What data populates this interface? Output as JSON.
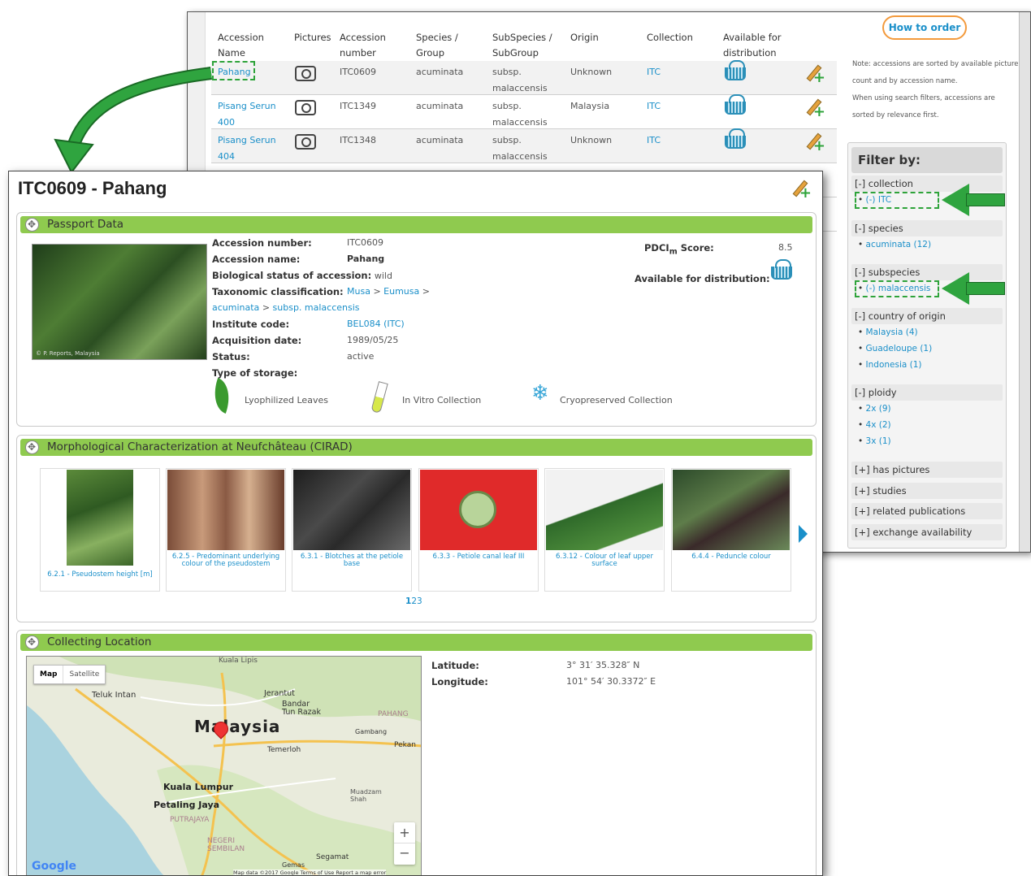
{
  "list": {
    "headers": {
      "name": "Accession\nName",
      "pictures": "Pictures",
      "number": "Accession\nnumber",
      "species": "Species /\nGroup",
      "subspecies": "SubSpecies /\nSubGroup",
      "origin": "Origin",
      "collection": "Collection",
      "available": "Available for\ndistribution"
    },
    "rows": [
      {
        "name": "Pahang",
        "number": "ITC0609",
        "species": "acuminata",
        "subspecies": "subsp.\nmalaccensis",
        "origin": "Unknown",
        "collection": "ITC"
      },
      {
        "name": "Pisang Serun\n400",
        "number": "ITC1349",
        "species": "acuminata",
        "subspecies": "subsp.\nmalaccensis",
        "origin": "Malaysia",
        "collection": "ITC"
      },
      {
        "name": "Pisang Serun\n404",
        "number": "ITC1348",
        "species": "acuminata",
        "subspecies": "subsp.\nmalaccensis",
        "origin": "Unknown",
        "collection": "ITC"
      }
    ],
    "how_to_order": "How to order",
    "note1": "Note: accessions are sorted by available picture count and by accession name.",
    "note2": "When using search filters, accessions are sorted by relevance first."
  },
  "filter": {
    "title": "Filter by:",
    "collection": {
      "head": "[-] collection",
      "items": [
        "(-) ITC"
      ]
    },
    "species": {
      "head": "[-] species",
      "items": [
        "acuminata (12)"
      ]
    },
    "subspecies": {
      "head": "[-] subspecies",
      "items": [
        "(-) malaccensis"
      ]
    },
    "country": {
      "head": "[-] country of origin",
      "items": [
        "Malaysia (4)",
        "Guadeloupe (1)",
        "Indonesia (1)"
      ]
    },
    "ploidy": {
      "head": "[-] ploidy",
      "items": [
        "2x (9)",
        "4x (2)",
        "3x (1)"
      ]
    },
    "collapsed": [
      "[+] has pictures",
      "[+] studies",
      "[+] related publications",
      "[+] exchange availability"
    ]
  },
  "detail": {
    "title": "ITC0609 - Pahang",
    "passport": {
      "head": "Passport Data",
      "photo_credit": "© P. Reports, Malaysia",
      "accession_number_label": "Accession number:",
      "accession_number": "ITC0609",
      "accession_name_label": "Accession name:",
      "accession_name": "Pahang",
      "bio_status_label": "Biological status of accession:",
      "bio_status": "wild",
      "taxonomic_label": "Taxonomic classification:",
      "taxonomy_musa": "Musa",
      "taxonomy_sep1": ">",
      "taxonomy_eumusa": "Eumusa",
      "taxonomy_sep2": ">",
      "taxonomy_acuminata": "acuminata",
      "taxonomy_sep3": ">",
      "taxonomy_subsp": "subsp. malaccensis",
      "institute_label": "Institute code:",
      "institute": "BEL084 (ITC)",
      "acquisition_label": "Acquisition date:",
      "acquisition": "1989/05/25",
      "status_label": "Status:",
      "status": "active",
      "storage_label": "Type of storage:",
      "storage": [
        "Lyophilized Leaves",
        "In Vitro Collection",
        "Cryopreserved Collection"
      ],
      "pdci_label_pre": "PDCI",
      "pdci_label_sub": "m",
      "pdci_label_post": " Score:",
      "pdci": "8.5",
      "available_label": "Available for distribution:"
    },
    "morph": {
      "head": "Morphological Characterization at Neufchâteau (CIRAD)",
      "items": [
        "6.2.1 - Pseudostem height [m]",
        "6.2.5 - Predominant underlying colour of the pseudostem",
        "6.3.1 - Blotches at the petiole base",
        "6.3.3 - Petiole canal leaf III",
        "6.3.12 - Colour of leaf upper surface",
        "6.4.4 - Peduncle colour"
      ],
      "pages": [
        "1",
        "2",
        "3"
      ]
    },
    "location": {
      "head": "Collecting Location",
      "latitude_label": "Latitude:",
      "latitude": "3° 31′ 35.328″ N",
      "longitude_label": "Longitude:",
      "longitude": "101° 54′ 30.3372″ E",
      "map_btn": "Map",
      "satellite_btn": "Satellite",
      "places": [
        "Kuala Lipis",
        "Teluk Intan",
        "Jerantut",
        "Bandar\nTun Razak",
        "PAHANG",
        "Malaysia",
        "Gambang",
        "Pekan",
        "Temerloh",
        "Kuala Lumpur",
        "Petaling Jaya",
        "PUTRAJAYA",
        "Muadzam\nShah",
        "NEGERI\nSEMBILAN",
        "Segamat",
        "Gemas"
      ],
      "attribution": "Map data ©2017 Google   Terms of Use   Report a map error",
      "google": "Google",
      "zoom_in": "+",
      "zoom_out": "−"
    }
  },
  "colors": {
    "green": "#8fca4f",
    "link": "#1a8fc9",
    "orange": "#f39a3c",
    "arrow": "#2fa43f"
  }
}
